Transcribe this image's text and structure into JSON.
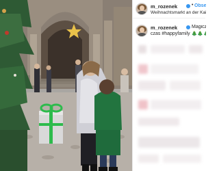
{
  "post": {
    "username": "m_rozenek",
    "follow_label": "Obserwowanie",
    "location": "Weihnachtsmarkt an der Kaiser-Wilh",
    "caption_username": "m_rozenek",
    "caption_text": "Magiczny świąteczny",
    "caption_line2": "czas #happyfamily 🎄🎄🎄"
  },
  "colors": {
    "accent": "#3897f0",
    "text": "#262626",
    "gift_green": "#2dbb4c",
    "jacket_green": "#1f6b3c"
  },
  "icons": [
    "verified-icon",
    "avatar"
  ]
}
